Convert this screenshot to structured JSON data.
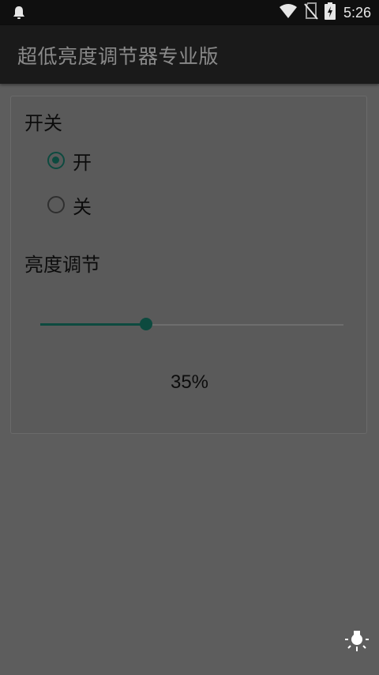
{
  "status_bar": {
    "time": "5:26",
    "icons": [
      "notification-bell-icon",
      "wifi-icon",
      "no-sim-icon",
      "battery-charging-icon"
    ]
  },
  "app_bar": {
    "title": "超低亮度调节器专业版"
  },
  "switch_section": {
    "label": "开关",
    "options": [
      {
        "label": "开",
        "checked": true
      },
      {
        "label": "关",
        "checked": false
      }
    ]
  },
  "brightness_section": {
    "label": "亮度调节",
    "value_percent": 35,
    "value_text": "35%"
  },
  "colors": {
    "accent": "#0d4a3f",
    "background": "#5d5d5d",
    "app_bar": "#1a1a1a",
    "status_bar": "#0f0f0f"
  },
  "fab_icon": "light-bulb-icon"
}
